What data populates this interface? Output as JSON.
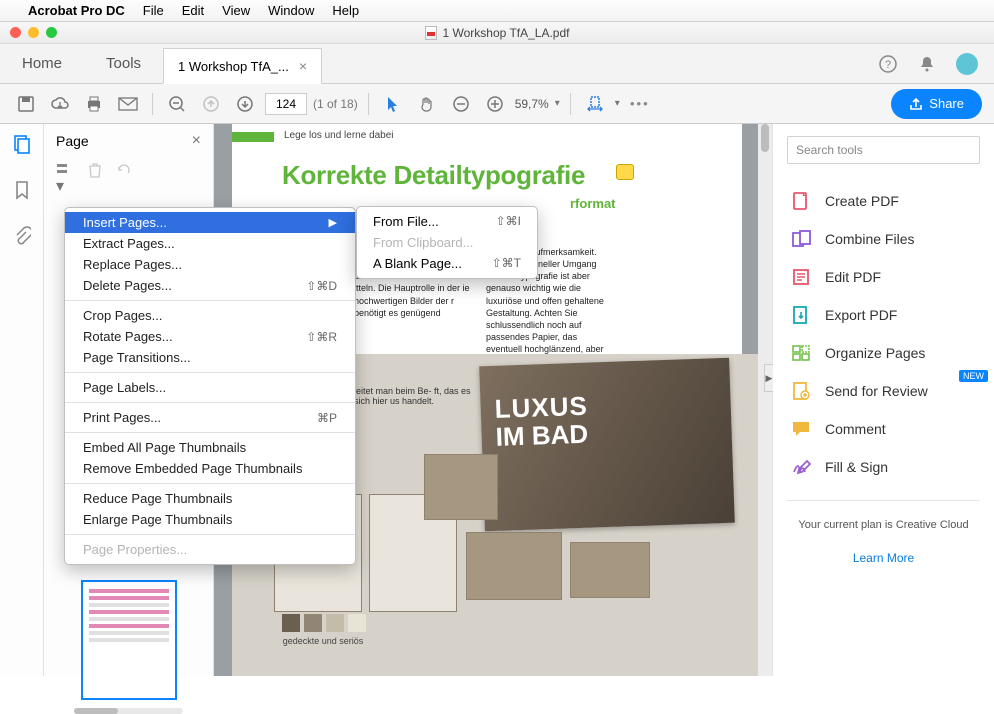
{
  "macmenu": {
    "app": "Acrobat Pro DC",
    "items": [
      "File",
      "Edit",
      "View",
      "Window",
      "Help"
    ]
  },
  "window": {
    "title": "1 Workshop TfA_LA.pdf"
  },
  "tabs": {
    "home": "Home",
    "tools": "Tools",
    "doc": "1  Workshop TfA_..."
  },
  "toolbar": {
    "page_value": "124",
    "page_count": "(1 of 18)",
    "zoom": "59,7%",
    "share": "Share"
  },
  "pagepanel": {
    "title": "Page"
  },
  "doc": {
    "caption": "Lege los und lerne dabei",
    "headline": "Korrekte Detailtypografie",
    "subhead": "rformat",
    "col_r1": "Querformat wirbt für Luxus-\nl Preise liegen im hochwer-\ndieses Gefühl soll die Bro-\nitteln. Die Hauptrolle in der\nie hochwertigen Bilder der\nr benötigt es genügend",
    "col_r2": "Raum und Aufmerksamkeit. Ein professioneller Umgang mit der Typografie ist aber genauso wichtig wie die luxuriöse und offen gehaltene Gestaltung. Achten Sie schlussendlich noch auf passendes Papier, das eventuell hochglänzend, aber vor allem stark genug sein sollte.",
    "gray_text": "leitet man beim Be-\nft, das es sich hier\nus handelt.",
    "lux1": "LUXUS",
    "lux2a": "IM ",
    "lux2b": "BAD",
    "swatch_label": "gedeckte und seriös"
  },
  "ctx": {
    "items": [
      {
        "label": "Insert Pages...",
        "highlight": true,
        "submenu": true
      },
      {
        "label": "Extract Pages..."
      },
      {
        "label": "Replace Pages..."
      },
      {
        "label": "Delete Pages...",
        "shortcut": "⇧⌘D"
      },
      {
        "divider": true
      },
      {
        "label": "Crop Pages..."
      },
      {
        "label": "Rotate Pages...",
        "shortcut": "⇧⌘R"
      },
      {
        "label": "Page Transitions..."
      },
      {
        "divider": true
      },
      {
        "label": "Page Labels..."
      },
      {
        "divider": true
      },
      {
        "label": "Print Pages...",
        "shortcut": "⌘P"
      },
      {
        "divider": true
      },
      {
        "label": "Embed All Page Thumbnails"
      },
      {
        "label": "Remove Embedded Page Thumbnails"
      },
      {
        "divider": true
      },
      {
        "label": "Reduce Page Thumbnails"
      },
      {
        "label": "Enlarge Page Thumbnails"
      },
      {
        "divider": true
      },
      {
        "label": "Page Properties...",
        "disabled": true
      }
    ],
    "submenu": [
      {
        "label": "From File...",
        "shortcut": "⇧⌘I"
      },
      {
        "label": "From Clipboard...",
        "disabled": true
      },
      {
        "label": "A Blank Page...",
        "shortcut": "⇧⌘T"
      }
    ]
  },
  "right": {
    "search_placeholder": "Search tools",
    "tools": [
      {
        "label": "Create PDF",
        "color": "#e8556e",
        "icon": "create"
      },
      {
        "label": "Combine Files",
        "color": "#8d5bd6",
        "icon": "combine"
      },
      {
        "label": "Edit PDF",
        "color": "#e8556e",
        "icon": "edit"
      },
      {
        "label": "Export PDF",
        "color": "#17a8b5",
        "icon": "export"
      },
      {
        "label": "Organize Pages",
        "color": "#73c24a",
        "icon": "organize"
      },
      {
        "label": "Send for Review",
        "color": "#f0b83e",
        "icon": "send",
        "badge": "NEW"
      },
      {
        "label": "Comment",
        "color": "#f0b83e",
        "icon": "comment"
      },
      {
        "label": "Fill & Sign",
        "color": "#9b5fd1",
        "icon": "sign"
      }
    ],
    "plan": "Your current plan is Creative Cloud",
    "learn": "Learn More"
  }
}
